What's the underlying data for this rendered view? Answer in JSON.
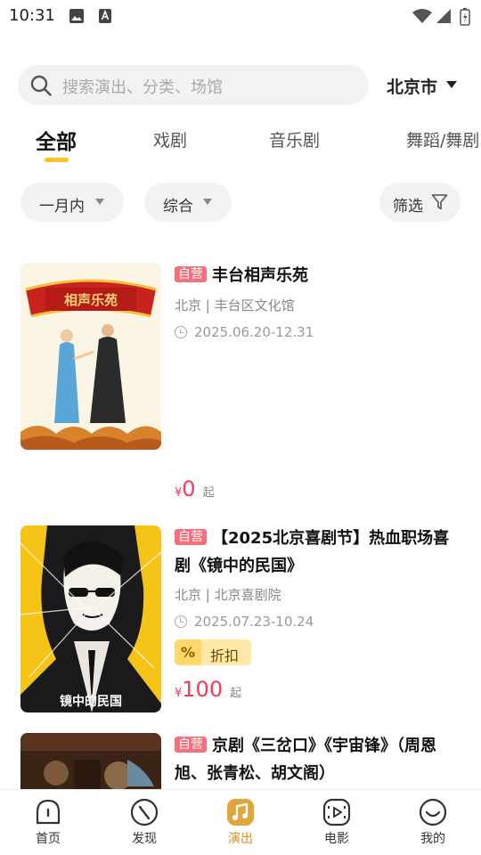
{
  "status_bar": {
    "time": "10:31"
  },
  "search": {
    "placeholder": "搜索演出、分类、场馆",
    "city": "北京市"
  },
  "tabs": [
    {
      "label": "全部",
      "active": true
    },
    {
      "label": "戏剧",
      "active": false
    },
    {
      "label": "音乐剧",
      "active": false
    },
    {
      "label": "舞蹈/舞剧",
      "active": false
    }
  ],
  "filters": {
    "time_range": "一月内",
    "sort": "综合",
    "screen": "筛选"
  },
  "shows": [
    {
      "badge": "自营",
      "title": "丰台相声乐苑",
      "venue": "北京 | 丰台区文化馆",
      "date": "2025.06.20-12.31",
      "price_symbol": "¥",
      "price": "0",
      "price_suffix": "起",
      "poster_text": "相声乐苑"
    },
    {
      "badge": "自营",
      "title": "【2025北京喜剧节】热血职场喜剧《镜中的民国》",
      "venue": "北京 | 北京喜剧院",
      "date": "2025.07.23-10.24",
      "discount_icon": "%",
      "discount_label": "折扣",
      "price_symbol": "¥",
      "price": "100",
      "price_suffix": "起",
      "poster_text": "镜中的民国"
    },
    {
      "badge": "自营",
      "title": "京剧《三岔口》《宇宙锋》（周恩旭、张青松、胡文阁）"
    }
  ],
  "bottom_nav": [
    {
      "label": "首页",
      "icon": "home-icon",
      "active": false
    },
    {
      "label": "发现",
      "icon": "compass-icon",
      "active": false
    },
    {
      "label": "演出",
      "icon": "music-note-icon",
      "active": true
    },
    {
      "label": "电影",
      "icon": "film-icon",
      "active": false
    },
    {
      "label": "我的",
      "icon": "profile-smile-icon",
      "active": false
    }
  ],
  "colors": {
    "accent": "#ffc21e",
    "price": "#f5375a",
    "badge": "#f76d7a",
    "nav_active": "#d98d1a"
  }
}
